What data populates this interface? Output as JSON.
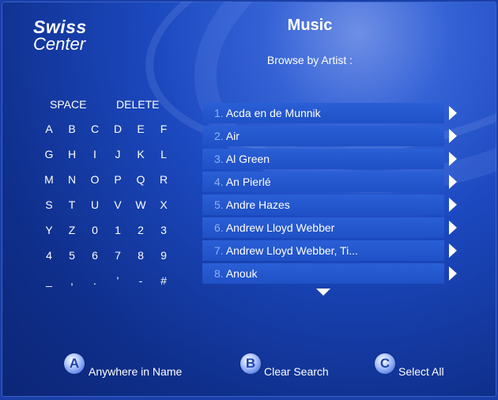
{
  "logo": {
    "line1": "Swiss",
    "line2": "Center"
  },
  "header": {
    "title": "Music",
    "subtitle": "Browse by Artist :"
  },
  "keyboard": {
    "space_label": "SPACE",
    "delete_label": "DELETE",
    "rows": [
      [
        "A",
        "B",
        "C",
        "D",
        "E",
        "F"
      ],
      [
        "G",
        "H",
        "I",
        "J",
        "K",
        "L"
      ],
      [
        "M",
        "N",
        "O",
        "P",
        "Q",
        "R"
      ],
      [
        "S",
        "T",
        "U",
        "V",
        "W",
        "X"
      ],
      [
        "Y",
        "Z",
        "0",
        "1",
        "2",
        "3"
      ],
      [
        "4",
        "5",
        "6",
        "7",
        "8",
        "9"
      ],
      [
        "_",
        ",",
        ".",
        "'",
        "-",
        "#"
      ]
    ]
  },
  "artists": [
    {
      "num": "1.",
      "name": "Acda en de Munnik"
    },
    {
      "num": "2.",
      "name": "Air"
    },
    {
      "num": "3.",
      "name": "Al Green"
    },
    {
      "num": "4.",
      "name": "An Pierlé"
    },
    {
      "num": "5.",
      "name": "Andre Hazes"
    },
    {
      "num": "6.",
      "name": "Andrew Lloyd Webber"
    },
    {
      "num": "7.",
      "name": "Andrew Lloyd Webber, Ti..."
    },
    {
      "num": "8.",
      "name": "Anouk"
    }
  ],
  "buttons": [
    {
      "letter": "A",
      "label": "Anywhere in Name"
    },
    {
      "letter": "B",
      "label": "Clear Search"
    },
    {
      "letter": "C",
      "label": "Select All"
    }
  ],
  "colors": {
    "background": "#1c49c0",
    "row": "#2358cf",
    "number": "#8fb0f0"
  }
}
